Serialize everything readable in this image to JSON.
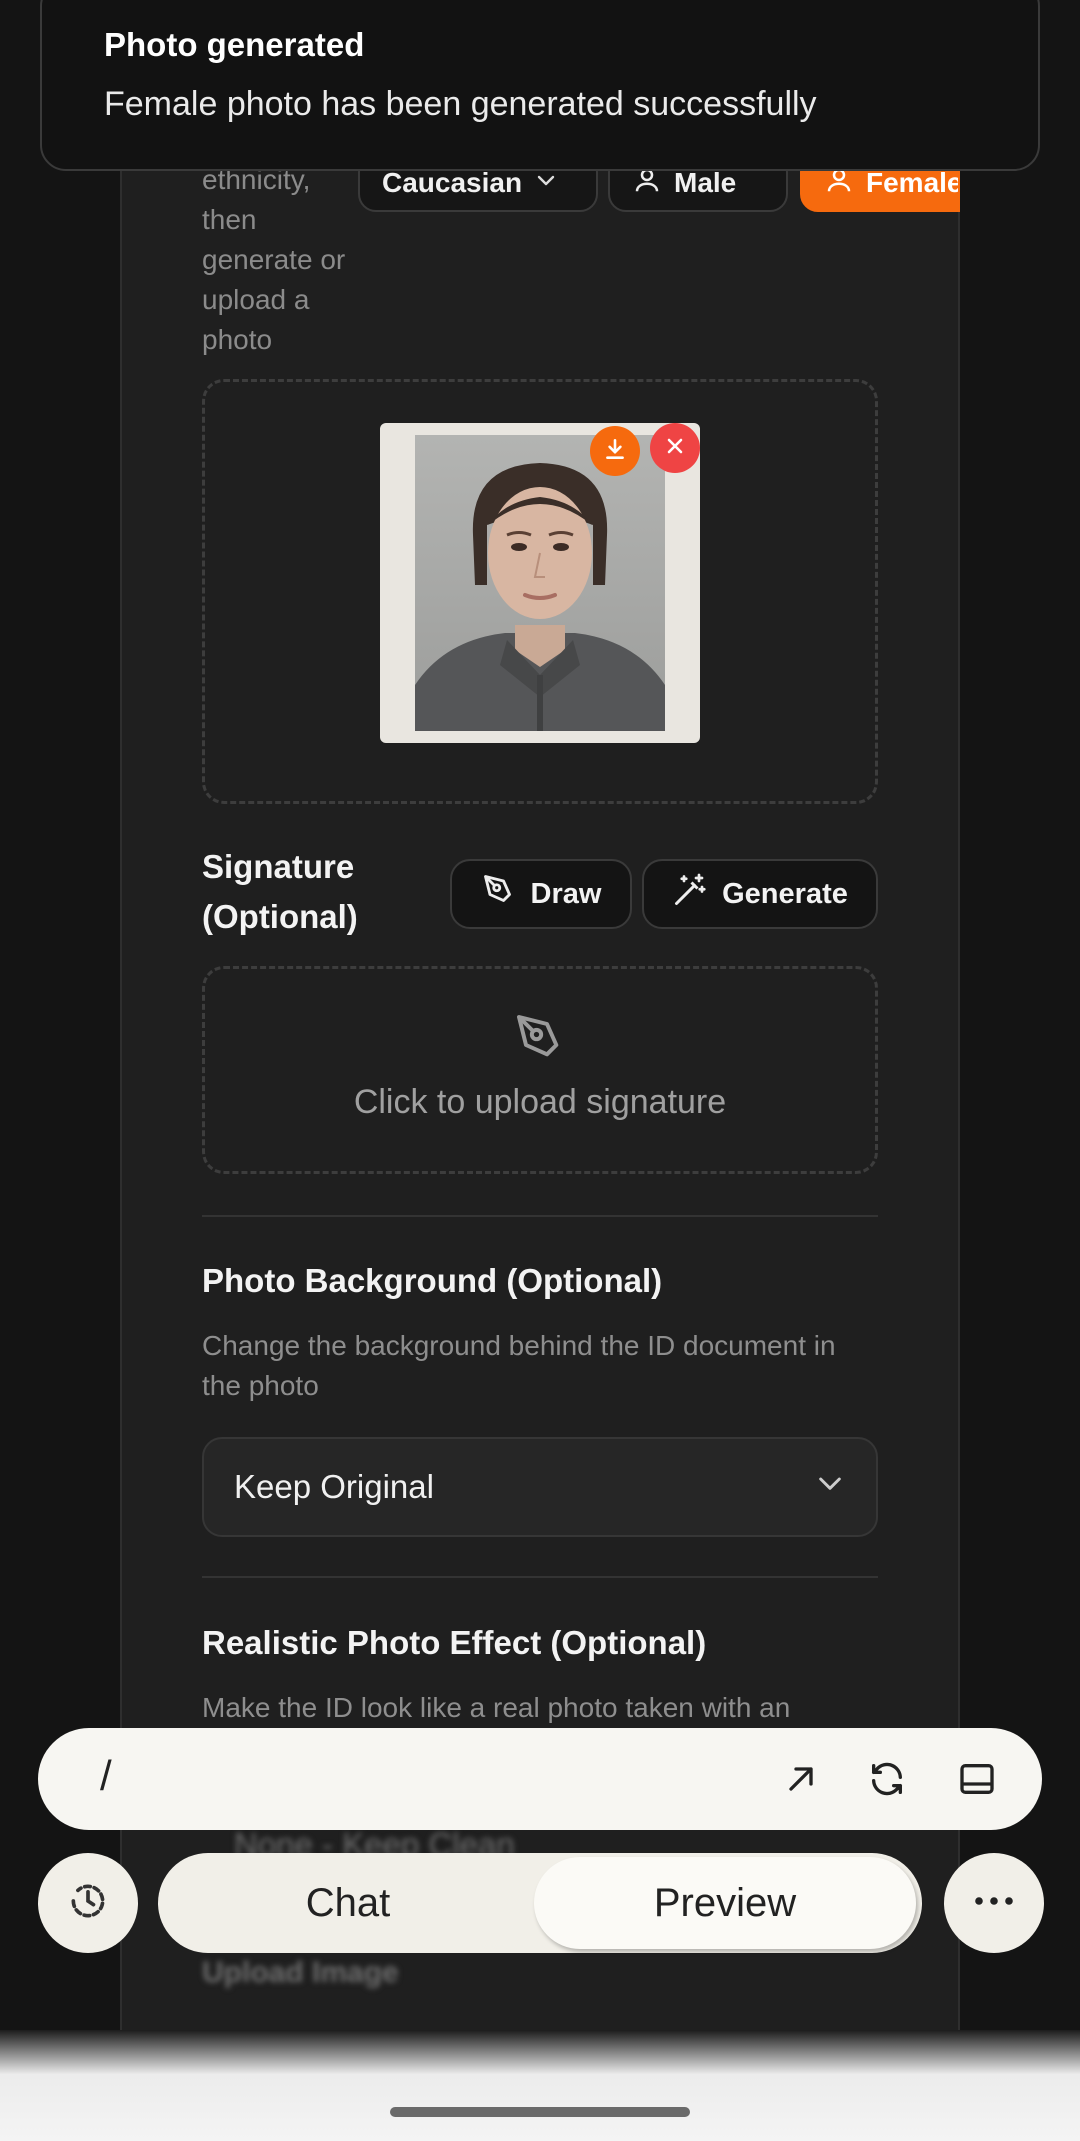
{
  "toast": {
    "title": "Photo generated",
    "message": "Female photo has been generated successfully"
  },
  "photo_section": {
    "intro_text": "ethnicity, then generate or upload a photo",
    "ethnicity_select": "Caucasian",
    "gender_buttons": [
      "Male",
      "Female"
    ],
    "selected_gender": "Female"
  },
  "signature": {
    "title": "Signature (Optional)",
    "draw_label": "Draw",
    "generate_label": "Generate",
    "upload_label": "Click to upload signature"
  },
  "background": {
    "title": "Photo Background (Optional)",
    "description": "Change the background behind the ID document in the photo",
    "selected": "Keep Original"
  },
  "realistic": {
    "title": "Realistic Photo Effect (Optional)",
    "description": "Make the ID look like a real photo taken with an",
    "selected": "None - Keep Clean",
    "upload_label": "Upload Image"
  },
  "command_bar": {
    "input_value": "/"
  },
  "tabs": {
    "items": [
      "Chat",
      "Preview"
    ],
    "active": "Preview"
  },
  "colors": {
    "accent": "#f66a0e",
    "danger": "#ef4444",
    "background": "#141414",
    "panel": "#1f1f1f"
  }
}
